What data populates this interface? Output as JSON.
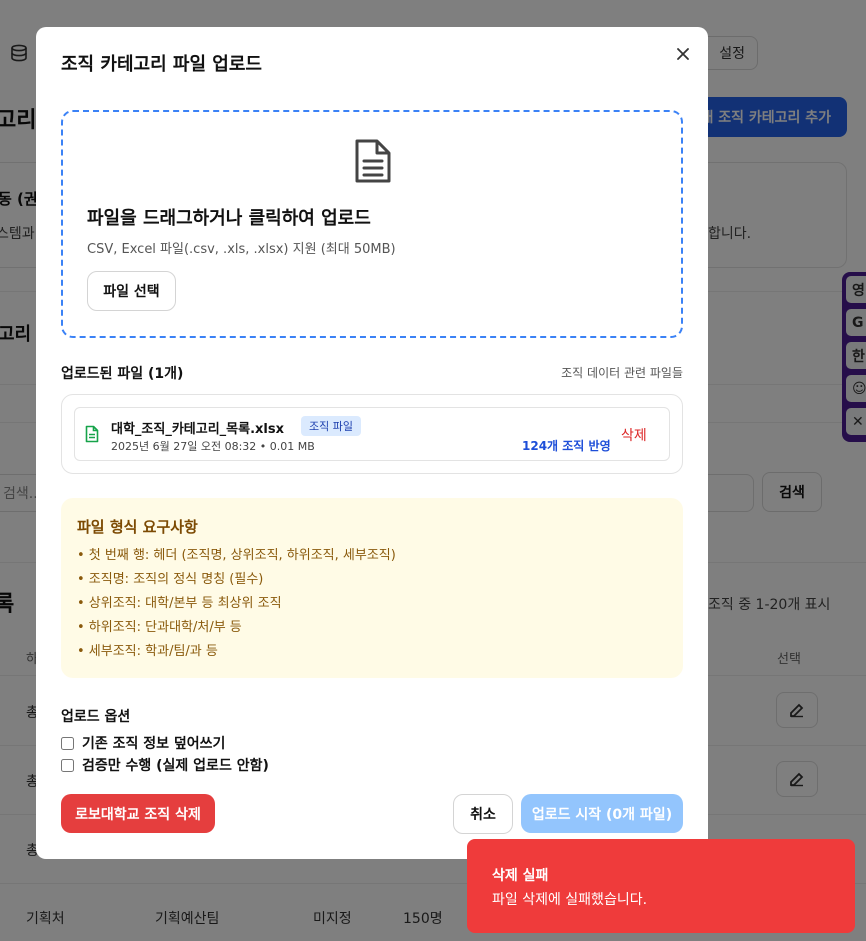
{
  "background": {
    "settings_label": "설정",
    "page_title": "고리",
    "add_category_button": "새 조직 카테고리 추가",
    "card_title": "동 (권",
    "card_desc_left": "스템과",
    "card_desc_right": "합니다.",
    "section_title": "고리 검",
    "search_placeholder": "검색...",
    "search_button": "검색",
    "list_title": "록",
    "list_count": "조직 중 1-20개 표시",
    "col_left": "하",
    "col_select": "선택",
    "row_first_chars": [
      "총",
      "총",
      "총"
    ],
    "last_row": {
      "col1": "기획처",
      "col2": "기획예산팀",
      "col3": "미지정",
      "col4": "150명"
    },
    "extension_buttons": [
      "영",
      "G",
      "한",
      "☺",
      "✕"
    ]
  },
  "modal": {
    "title": "조직 카테고리 파일 업로드",
    "dropzone": {
      "title": "파일을 드래그하거나 클릭하여 업로드",
      "subtitle": "CSV, Excel 파일(.csv, .xls, .xlsx) 지원 (최대 50MB)",
      "button": "파일 선택"
    },
    "uploaded": {
      "heading": "업로드된 파일 (1개)",
      "hint": "조직 데이터 관련 파일들",
      "files": [
        {
          "name": "대학_조직_카테고리_목록.xlsx",
          "badge": "조직 파일",
          "meta": "2025년 6월 27일 오전 08:32 • 0.01 MB",
          "count": "124개 조직 반영",
          "delete": "삭제"
        }
      ]
    },
    "requirements": {
      "title": "파일 형식 요구사항",
      "items": [
        "• 첫 번째 행: 헤더 (조직명, 상위조직, 하위조직, 세부조직)",
        "• 조직명: 조직의 정식 명칭 (필수)",
        "• 상위조직: 대학/본부 등 최상위 조직",
        "• 하위조직: 단과대학/처/부 등",
        "• 세부조직: 학과/팀/과 등"
      ]
    },
    "options": {
      "heading": "업로드 옵션",
      "overwrite": "기존 조직 정보 덮어쓰기",
      "validate_only": "검증만 수행 (실제 업로드 안함)"
    },
    "buttons": {
      "delete_org": "로보대학교 조직 삭제",
      "cancel": "취소",
      "start": "업로드 시작 (0개 파일)"
    }
  },
  "toast": {
    "title": "삭제 실패",
    "message": "파일 삭제에 실패했습니다."
  },
  "colors": {
    "primary": "#2563eb",
    "danger": "#e53e3e",
    "toast": "#ef3b3b",
    "disabled_primary": "#93c5fd",
    "warning_bg": "#fffbe6"
  }
}
